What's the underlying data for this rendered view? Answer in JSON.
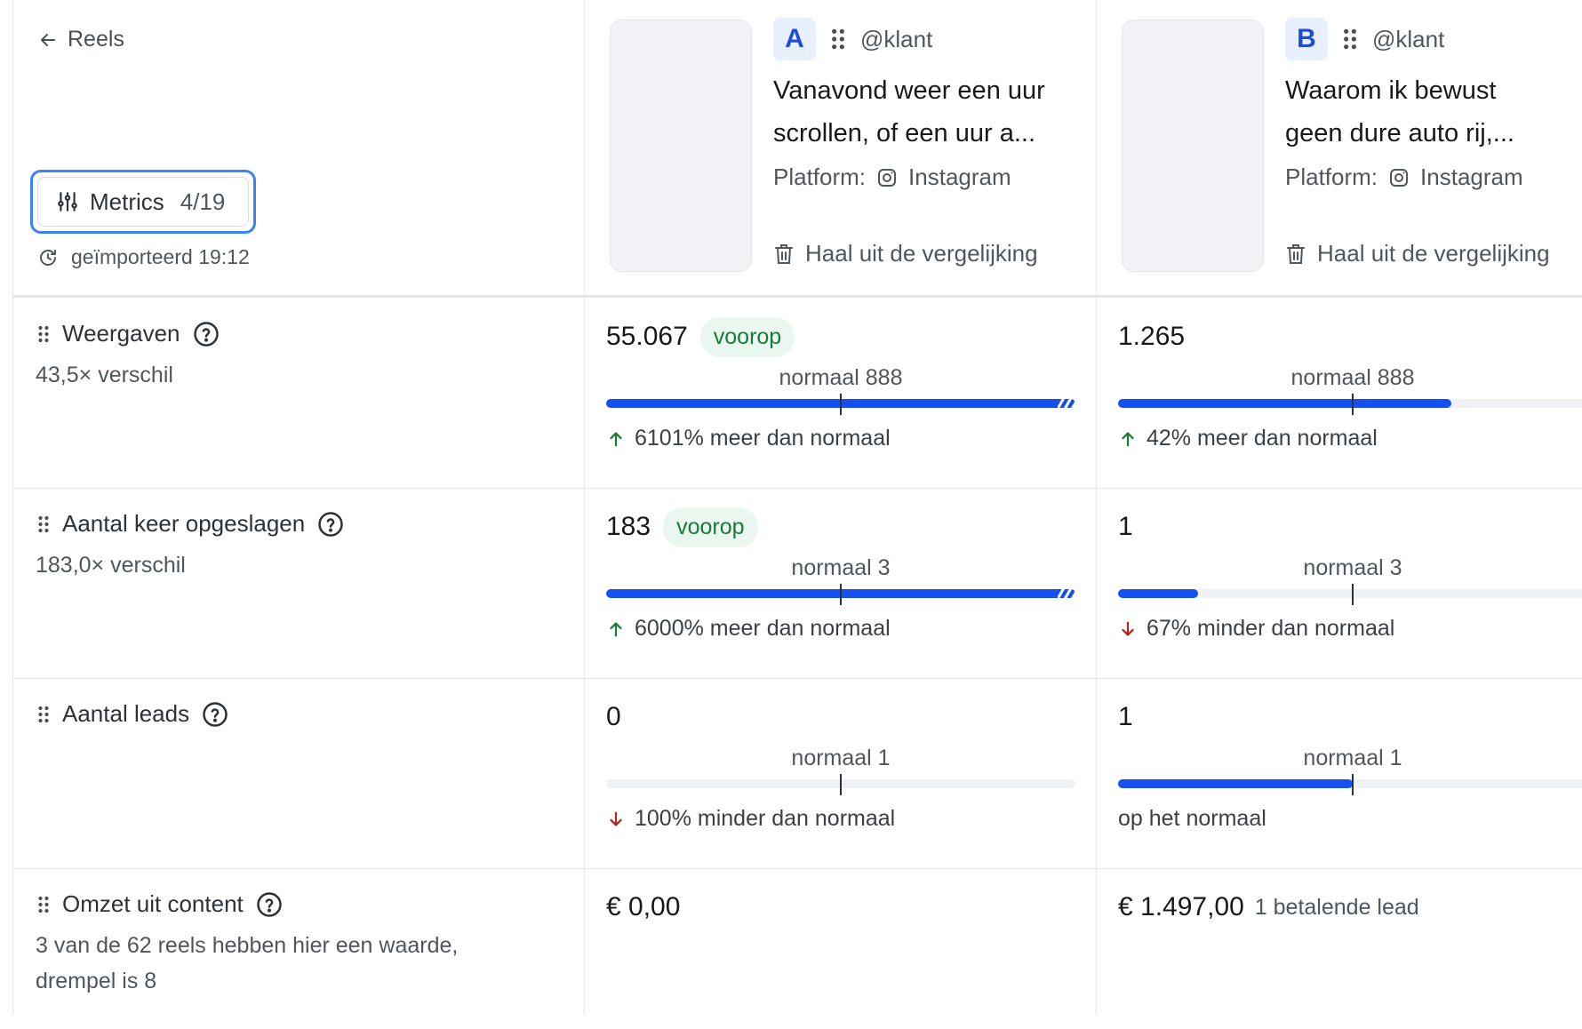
{
  "nav": {
    "back_label": "Reels"
  },
  "metrics_button": {
    "label": "Metrics",
    "count": "4/19"
  },
  "import_status": "geïmporteerd 19:12",
  "reels": [
    {
      "letter": "A",
      "account": "@klant",
      "title": "Vanavond weer een uur\nscrollen, of een uur a...",
      "platform_label": "Platform:",
      "platform": "Instagram",
      "remove_label": "Haal uit de vergelijking"
    },
    {
      "letter": "B",
      "account": "@klant",
      "title": "Waarom ik bewust\ngeen dure auto rij,...",
      "platform_label": "Platform:",
      "platform": "Instagram",
      "remove_label": "Haal uit de vergelijking"
    }
  ],
  "metrics": [
    {
      "label": "Weergaven",
      "sub": "43,5× verschil",
      "cells": [
        {
          "value": "55.067",
          "badge": "voorop",
          "normal": "normaal 888",
          "fill": 1.0,
          "over": true,
          "delta": "6101% meer dan normaal",
          "direction": "up"
        },
        {
          "value": "1.265",
          "badge": "",
          "normal": "normaal 888",
          "fill": 0.71,
          "over": false,
          "delta": "42% meer dan normaal",
          "direction": "up"
        }
      ]
    },
    {
      "label": "Aantal keer opgeslagen",
      "sub": "183,0× verschil",
      "cells": [
        {
          "value": "183",
          "badge": "voorop",
          "normal": "normaal 3",
          "fill": 1.0,
          "over": true,
          "delta": "6000% meer dan normaal",
          "direction": "up"
        },
        {
          "value": "1",
          "badge": "",
          "normal": "normaal 3",
          "fill": 0.17,
          "over": false,
          "delta": "67% minder dan normaal",
          "direction": "down"
        }
      ]
    },
    {
      "label": "Aantal leads",
      "sub": "",
      "cells": [
        {
          "value": "0",
          "badge": "",
          "normal": "normaal 1",
          "fill": 0.0,
          "over": false,
          "delta": "100% minder dan normaal",
          "direction": "down"
        },
        {
          "value": "1",
          "badge": "",
          "normal": "normaal 1",
          "fill": 0.5,
          "over": false,
          "delta": "op het normaal",
          "direction": "none"
        }
      ]
    },
    {
      "label": "Omzet uit content",
      "sub": "3 van de 62 reels hebben hier een waarde, drempel is 8",
      "cells": [
        {
          "value": "€ 0,00",
          "extra": ""
        },
        {
          "value": "€ 1.497,00",
          "extra": "1 betalende lead"
        }
      ]
    }
  ],
  "colors": {
    "bar": "#1650f0",
    "up": "#1a7a3a",
    "down": "#b42318",
    "accent_border": "#3b82f6"
  }
}
